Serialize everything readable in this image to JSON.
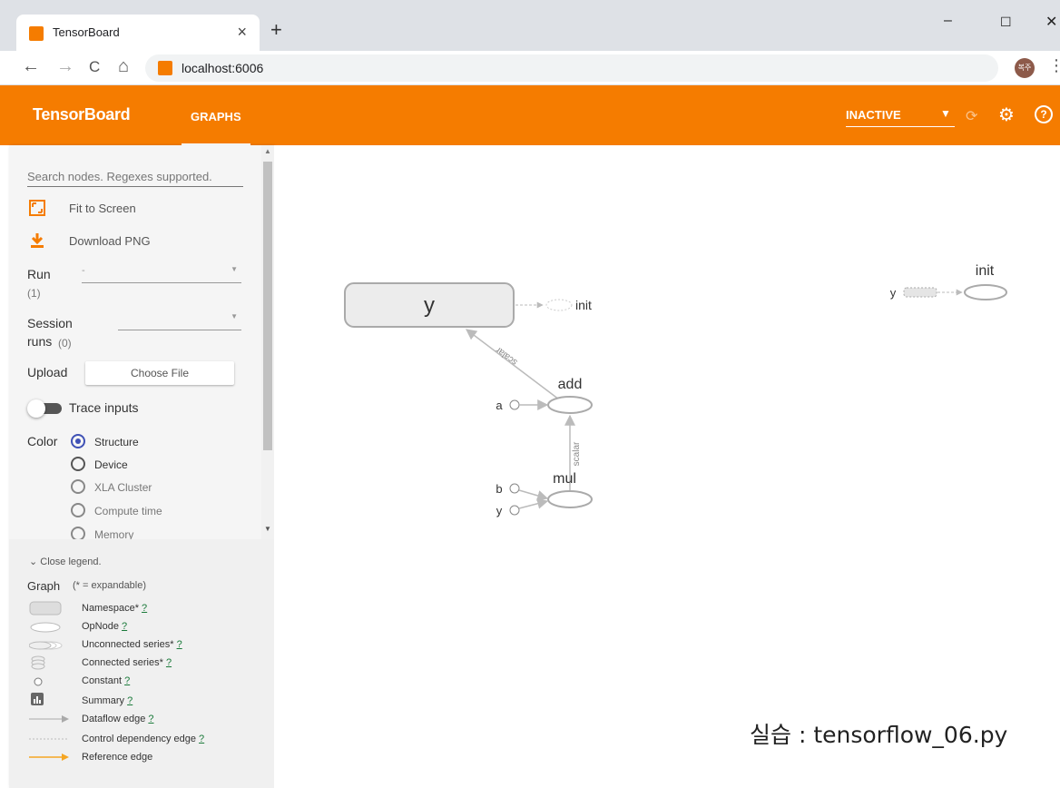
{
  "browser": {
    "tab_title": "TensorBoard",
    "tab_close": "×",
    "new_tab": "+",
    "url": "localhost:6006",
    "profile": "복주",
    "window_controls": {
      "minimize": "–",
      "maximize": "☐",
      "close": "✕"
    },
    "nav": {
      "back": "←",
      "forward": "→",
      "reload": "C",
      "home": "⌂",
      "menu": "⋮"
    }
  },
  "header": {
    "brand": "TensorBoard",
    "tab": "GRAPHS",
    "run_status": "INACTIVE",
    "accent_color": "#f57c00"
  },
  "sidebar": {
    "search_placeholder": "Search nodes. Regexes supported.",
    "fit_to_screen": "Fit to Screen",
    "download_png": "Download PNG",
    "run_label": "Run",
    "run_count": "(1)",
    "run_value": "-",
    "session_label": "Session",
    "session_label2": "runs",
    "session_count": "(0)",
    "upload_label": "Upload",
    "choose_file": "Choose File",
    "trace_inputs": "Trace inputs",
    "color_label": "Color",
    "color_options": [
      {
        "label": "Structure",
        "selected": true
      },
      {
        "label": "Device",
        "selected": false
      },
      {
        "label": "XLA Cluster",
        "selected": false
      },
      {
        "label": "Compute time",
        "selected": false
      },
      {
        "label": "Memory",
        "selected": false
      }
    ]
  },
  "legend": {
    "toggle": "Close legend.",
    "graph_label": "Graph",
    "expandable_note": "(* = expandable)",
    "help_mark": "?",
    "items": [
      {
        "label": "Namespace*",
        "icon": "namespace-icon"
      },
      {
        "label": "OpNode",
        "icon": "opnode-icon"
      },
      {
        "label": "Unconnected series*",
        "icon": "unconnected-series-icon"
      },
      {
        "label": "Connected series*",
        "icon": "connected-series-icon"
      },
      {
        "label": "Constant",
        "icon": "constant-icon"
      },
      {
        "label": "Summary",
        "icon": "summary-icon"
      },
      {
        "label": "Dataflow edge",
        "icon": "dataflow-edge-icon"
      },
      {
        "label": "Control dependency edge",
        "icon": "control-edge-icon"
      },
      {
        "label": "Reference edge",
        "icon": "reference-edge-icon"
      }
    ]
  },
  "graph": {
    "namespace_y": "y",
    "init_small": "init",
    "node_add": "add",
    "node_mul": "mul",
    "input_a": "a",
    "input_b": "b",
    "input_y": "y",
    "edge_scalar1": "scalar",
    "edge_scalar2": "scalar",
    "aux_init": "init",
    "aux_y": "y"
  },
  "caption": "실습 : tensorflow_06.py"
}
